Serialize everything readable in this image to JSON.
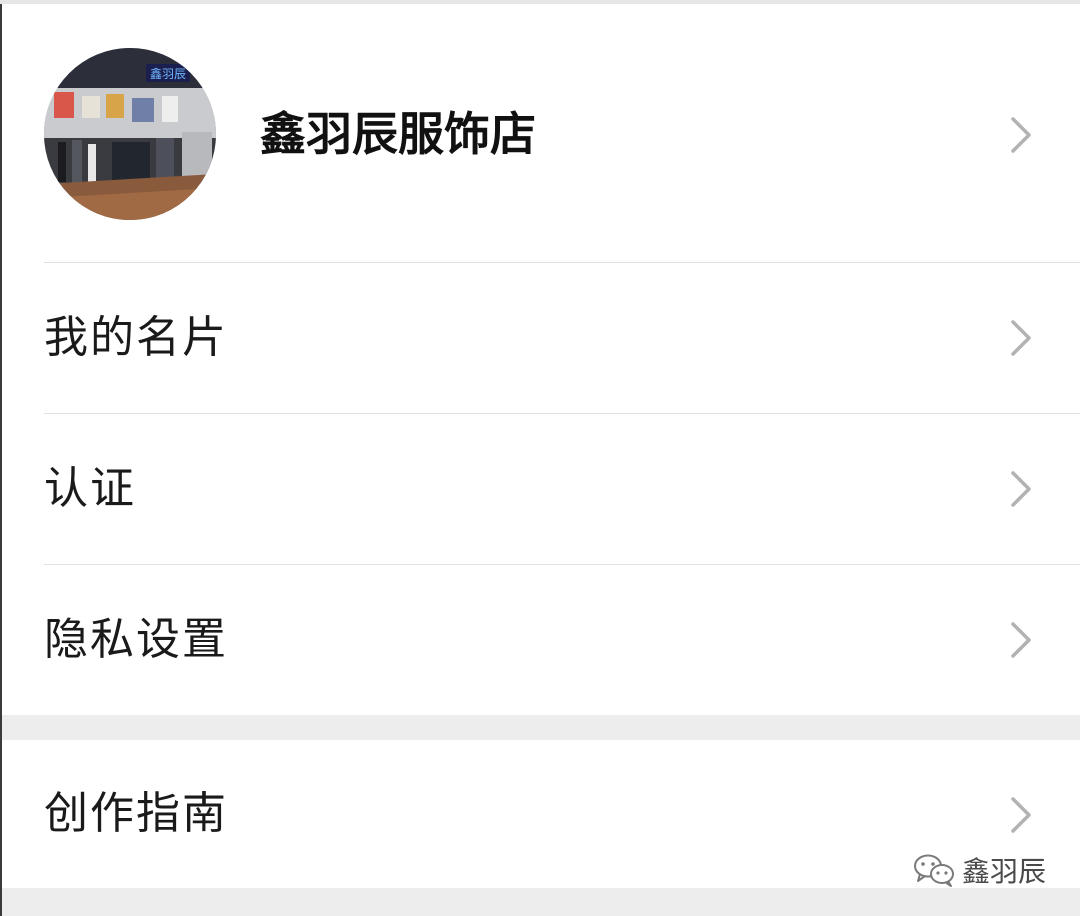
{
  "profile": {
    "name": "鑫羽辰服饰店",
    "avatar_sign_text": "鑫羽辰"
  },
  "menu": {
    "items": [
      {
        "label": "我的名片"
      },
      {
        "label": "认证"
      },
      {
        "label": "隐私设置"
      }
    ],
    "secondary_items": [
      {
        "label": "创作指南"
      }
    ]
  },
  "watermark": {
    "text": "鑫羽辰"
  },
  "icons": {
    "chevron": "chevron-right-icon",
    "watermark": "wechat-bubble-icon"
  },
  "colors": {
    "background": "#ededed",
    "card": "#ffffff",
    "divider": "#e2e2e2",
    "chevron": "#b2b2b2",
    "text": "#1a1a1a"
  }
}
